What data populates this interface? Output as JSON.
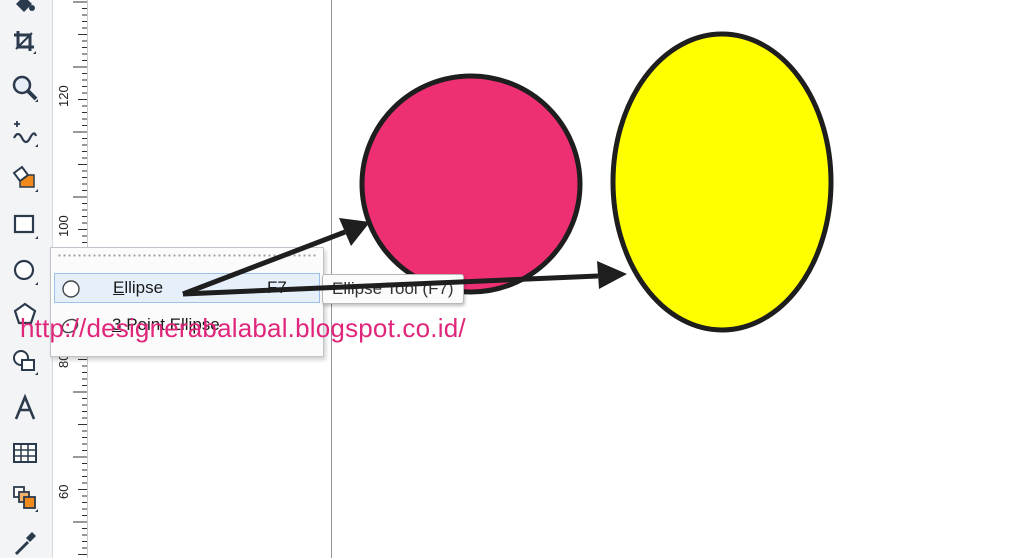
{
  "ruler": {
    "labels": [
      "120",
      "100",
      "80",
      "60"
    ]
  },
  "flyout": {
    "items": [
      {
        "mnemonic": "E",
        "rest": "llipse",
        "shortcut": "F7"
      },
      {
        "mnemonic": "3",
        "rest": " Point Ellipse",
        "shortcut": ""
      }
    ]
  },
  "tooltip": {
    "text": "Ellipse Tool (F7)"
  },
  "watermark": {
    "text": "http://designerabalabal.blogspot.co.id/"
  },
  "colors": {
    "circle_fill": "#ee2f73",
    "ellipse_fill": "#ffff00",
    "outline": "#1e1e1e",
    "watermark": "#e0267a",
    "accent_orange": "#f08a1c"
  }
}
